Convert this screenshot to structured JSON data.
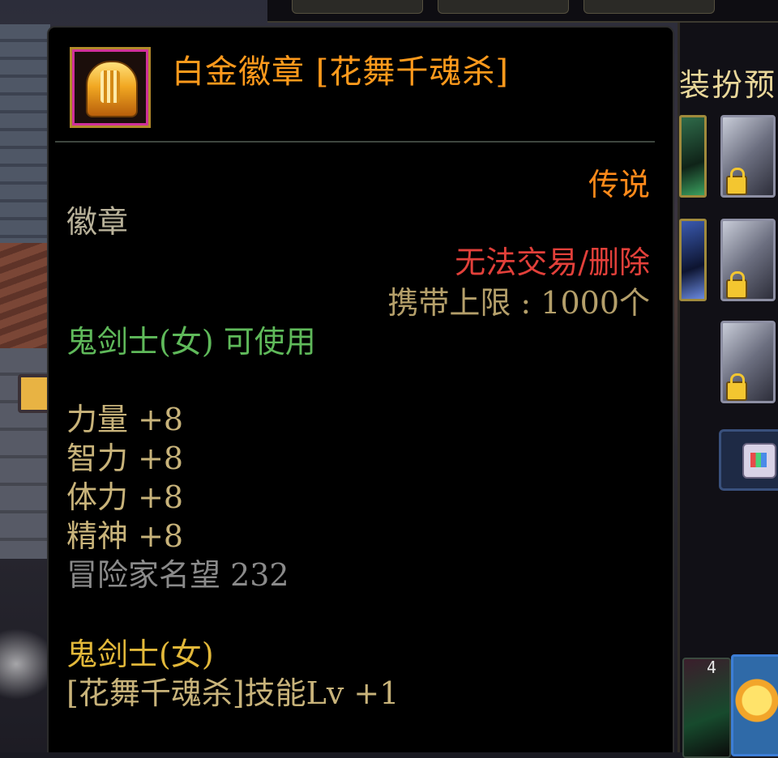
{
  "right_panel": {
    "preview_label": "装扮预"
  },
  "tooltip": {
    "item_name": "白金徽章 [花舞千魂杀]",
    "rarity": "传说",
    "item_type": "徽章",
    "trade_restriction": "无法交易/删除",
    "carry_limit": "携带上限 : 1000个",
    "usable_class": "鬼剑士(女) 可使用",
    "stats": [
      {
        "label": "力量 +8"
      },
      {
        "label": "智力 +8"
      },
      {
        "label": "体力 +8"
      },
      {
        "label": "精神 +8"
      }
    ],
    "fame": "冒险家名望 232",
    "skill_class": "鬼剑士(女)",
    "skill_bonus": "[花舞千魂杀]技能Lv +1"
  },
  "skill_slot_level": "4",
  "colors": {
    "item_name": "#ff9a1c",
    "rarity_legendary": "#ff8a1a",
    "untradeable": "#e2403a",
    "class_usable": "#5fb95a",
    "stat": "#c8b37a",
    "fame": "#8a8a8a"
  }
}
